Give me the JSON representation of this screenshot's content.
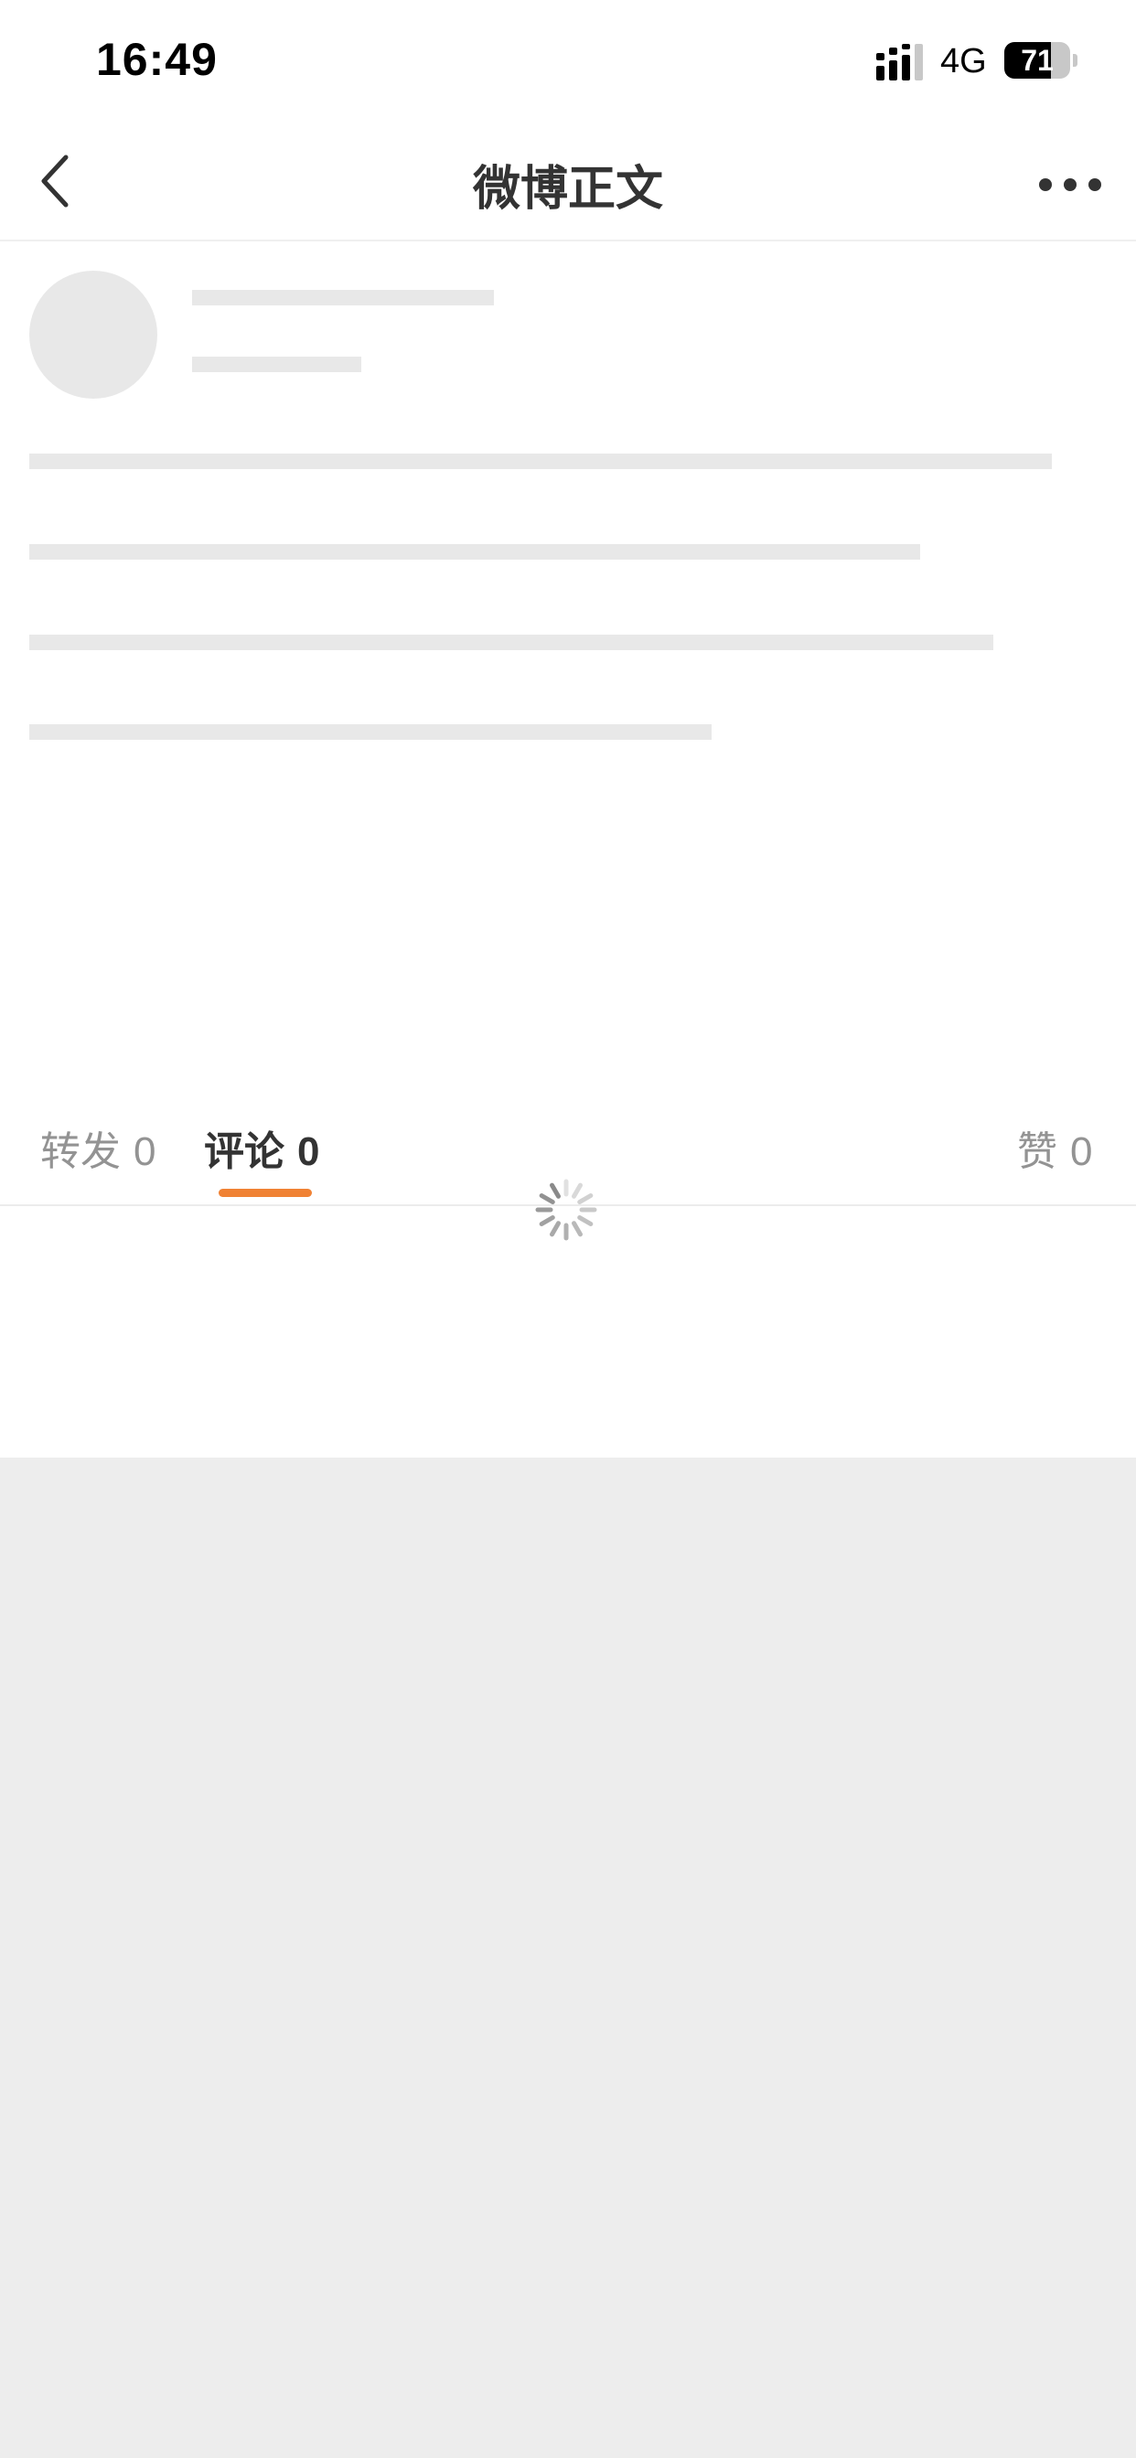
{
  "status_bar": {
    "time": "16:49",
    "network": "4G",
    "battery_level": "71",
    "battery_fraction": 0.71
  },
  "nav": {
    "title": "微博正文",
    "back_icon": "chevron-left-icon",
    "more_icon": "more-horizontal-icon"
  },
  "tabs": [
    {
      "label": "转发",
      "count": "0",
      "active": false
    },
    {
      "label": "评论",
      "count": "0",
      "active": true
    },
    {
      "label": "赞",
      "count": "0",
      "active": false
    }
  ],
  "loading_icon": "loading-spinner-icon",
  "colors": {
    "accent": "#f08234",
    "skeleton": "#e8e8e8",
    "background": "#ededed",
    "text_primary": "#333333",
    "text_secondary": "#939393"
  }
}
